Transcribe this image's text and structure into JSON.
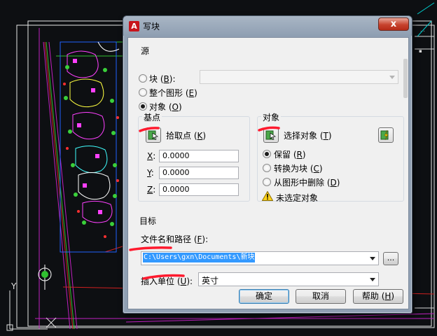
{
  "dialog": {
    "title": "写块",
    "close_glyph": "x"
  },
  "source": {
    "group_label": "源",
    "block_label": "块",
    "block_hotkey": "B",
    "block_suffix": ":",
    "entire_drawing_label": "整个图形",
    "entire_drawing_hotkey": "E",
    "objects_label": "对象",
    "objects_hotkey": "O",
    "selected": "objects"
  },
  "base_point": {
    "group_label": "基点",
    "pick_label": "拾取点",
    "pick_hotkey": "K",
    "x_label": "X",
    "y_label": "Y",
    "z_label": "Z",
    "x_value": "0.0000",
    "y_value": "0.0000",
    "z_value": "0.0000"
  },
  "objects": {
    "group_label": "对象",
    "select_label": "选择对象",
    "select_hotkey": "T",
    "retain_label": "保留",
    "retain_hotkey": "R",
    "convert_label": "转换为块",
    "convert_hotkey": "C",
    "delete_label": "从图形中删除",
    "delete_hotkey": "D",
    "selected": "retain",
    "warning_text": "未选定对象"
  },
  "destination": {
    "group_label": "目标",
    "filename_label": "文件名和路径",
    "filename_hotkey": "F",
    "filename_value": "C:\\Users\\gxn\\Documents\\新块",
    "browse_label": "...",
    "units_label": "插入单位",
    "units_hotkey": "U",
    "units_value": "英寸"
  },
  "buttons": {
    "ok": "确定",
    "cancel": "取消",
    "help": "帮助",
    "help_hotkey": "H"
  },
  "cad": {
    "ucs_y_label": "Y"
  },
  "colors": {
    "annotation_red": "#ff1a2e",
    "selection_blue": "#3399ff",
    "dialog_frame": "#8f9fb2"
  }
}
